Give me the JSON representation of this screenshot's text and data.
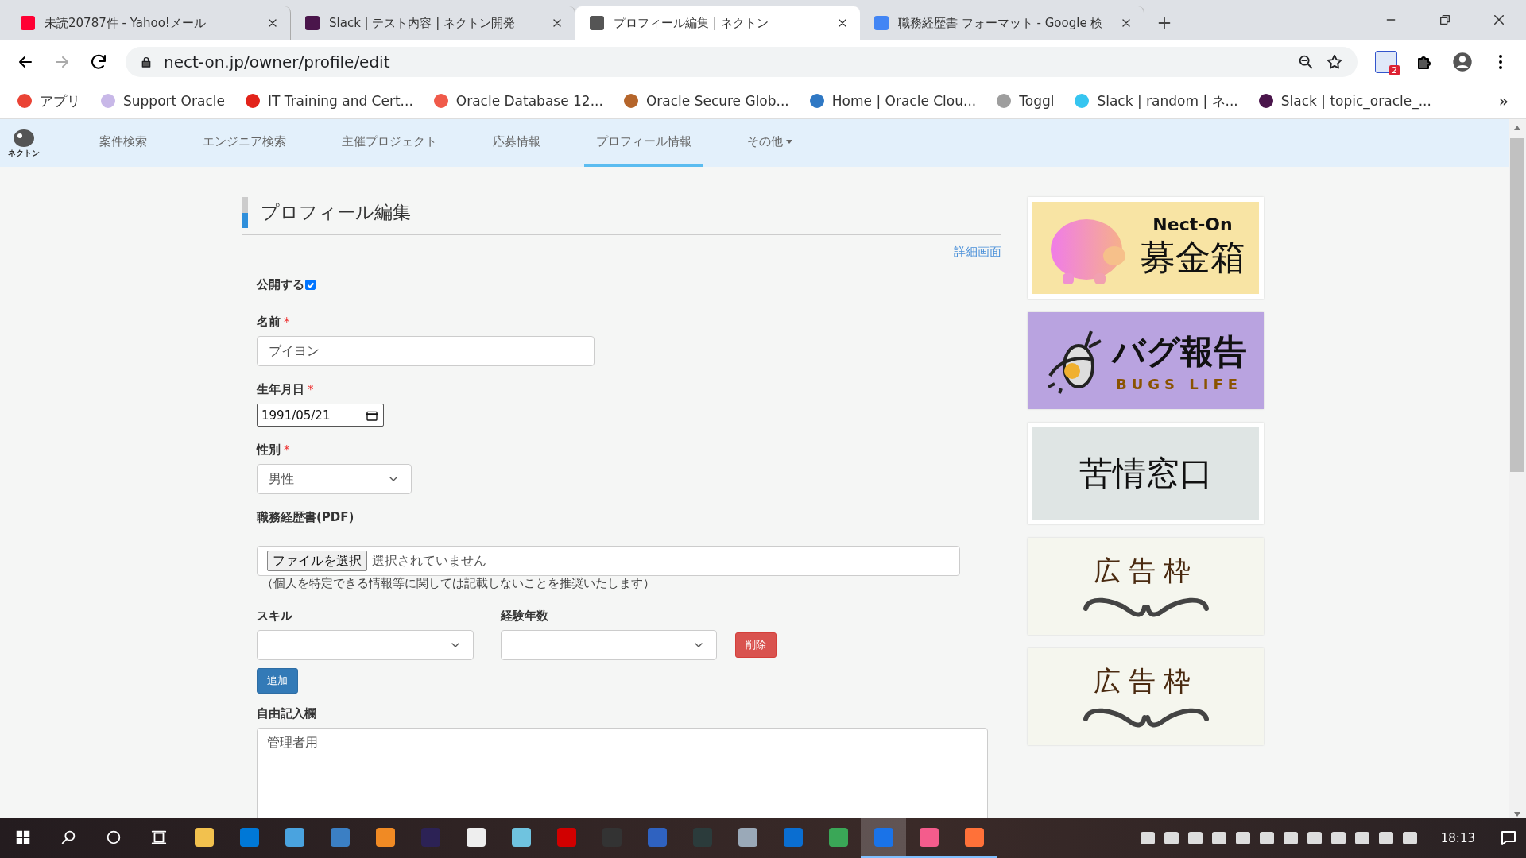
{
  "browser": {
    "tabs": [
      {
        "title": "未読20787件 - Yahoo!メール",
        "selected": false,
        "color": "#ff0033"
      },
      {
        "title": "Slack | テスト内容 | ネクトン開発",
        "selected": false,
        "color": "#4a154b"
      },
      {
        "title": "プロフィール編集 | ネクトン",
        "selected": true,
        "color": "#555555"
      },
      {
        "title": "職務経歴書 フォーマット - Google 検",
        "selected": false,
        "color": "#4285f4"
      }
    ],
    "address": "nect-on.jp/owner/profile/edit",
    "extension_badge": "2",
    "bookmarks": [
      {
        "title": "アプリ",
        "color": "#ea4335"
      },
      {
        "title": "Support Oracle",
        "color": "#c8b8e8"
      },
      {
        "title": "IT Training and Cert...",
        "color": "#e2231a"
      },
      {
        "title": "Oracle Database 12...",
        "color": "#f05a4a"
      },
      {
        "title": "Oracle Secure Glob...",
        "color": "#b5652b"
      },
      {
        "title": "Home | Oracle Clou...",
        "color": "#2f78c4"
      },
      {
        "title": "Toggl",
        "color": "#9e9e9e"
      },
      {
        "title": "Slack | random | ネ...",
        "color": "#36c5f0"
      },
      {
        "title": "Slack | topic_oracle_...",
        "color": "#4a154b"
      }
    ],
    "more_bookmarks": "»"
  },
  "site": {
    "logo_text": "ネクトン",
    "nav": [
      {
        "label": "案件検索",
        "selected": false,
        "kind": "link"
      },
      {
        "label": "エンジニア検索",
        "selected": false,
        "kind": "link"
      },
      {
        "label": "主催プロジェクト",
        "selected": false,
        "kind": "link"
      },
      {
        "label": "応募情報",
        "selected": false,
        "kind": "link"
      },
      {
        "label": "プロフィール情報",
        "selected": true,
        "kind": "link"
      },
      {
        "label": "その他",
        "selected": false,
        "kind": "dropdown"
      }
    ]
  },
  "form": {
    "title": "プロフィール編集",
    "detail_link": "詳細画面",
    "required_mark": "*",
    "publish": {
      "label": "公開する",
      "checked": true
    },
    "name": {
      "label": "名前",
      "required": true,
      "value": "ブイヨン"
    },
    "birthday": {
      "label": "生年月日",
      "required": true,
      "value": "1991/05/21"
    },
    "gender": {
      "label": "性別",
      "required": true,
      "value": "男性"
    },
    "resume": {
      "label": "職務経歴書(PDF)",
      "required": false,
      "button": "ファイルを選択",
      "status": "選択されていません",
      "note": "（個人を特定できる情報等に関しては記載しないことを推奨いたします）"
    },
    "skills": {
      "skill_label": "スキル",
      "years_label": "経験年数",
      "delete": "削除",
      "add": "追加"
    },
    "remarks": {
      "label": "自由記入欄",
      "required": false,
      "value": "管理者用"
    }
  },
  "banners": [
    {
      "kind": "donation",
      "title": "Nect-On",
      "text": "募金箱"
    },
    {
      "kind": "bugs",
      "text": "バグ報告",
      "subtitle": "BUGS LIFE"
    },
    {
      "kind": "complaint",
      "text": "苦情窓口"
    },
    {
      "kind": "ad",
      "text": "広告枠"
    },
    {
      "kind": "ad",
      "text": "広告枠"
    }
  ],
  "taskbar": {
    "apps": [
      {
        "color": "#f2c14e",
        "running": false,
        "selected": false
      },
      {
        "color": "#0078d7",
        "running": false,
        "selected": false
      },
      {
        "color": "#4aa3df",
        "running": false,
        "selected": false
      },
      {
        "color": "#3b7fc4",
        "running": false,
        "selected": false
      },
      {
        "color": "#f08a24",
        "running": false,
        "selected": false
      },
      {
        "color": "#2c2255",
        "running": false,
        "selected": false
      },
      {
        "color": "#eeeeee",
        "running": false,
        "selected": false
      },
      {
        "color": "#6fc3df",
        "running": false,
        "selected": false
      },
      {
        "color": "#d10000",
        "running": false,
        "selected": false
      },
      {
        "color": "#333333",
        "running": false,
        "selected": false
      },
      {
        "color": "#2f62c0",
        "running": false,
        "selected": false
      },
      {
        "color": "#2b3b3b",
        "running": false,
        "selected": false
      },
      {
        "color": "#9aa9b8",
        "running": false,
        "selected": false
      },
      {
        "color": "#0a6ed1",
        "running": false,
        "selected": false
      },
      {
        "color": "#3aa757",
        "running": false,
        "selected": false
      },
      {
        "color": "#1a73e8",
        "running": true,
        "selected": true
      },
      {
        "color": "#f45c8c",
        "running": true,
        "selected": false
      },
      {
        "color": "#ff7139",
        "running": true,
        "selected": false
      }
    ],
    "time": "18:13"
  }
}
